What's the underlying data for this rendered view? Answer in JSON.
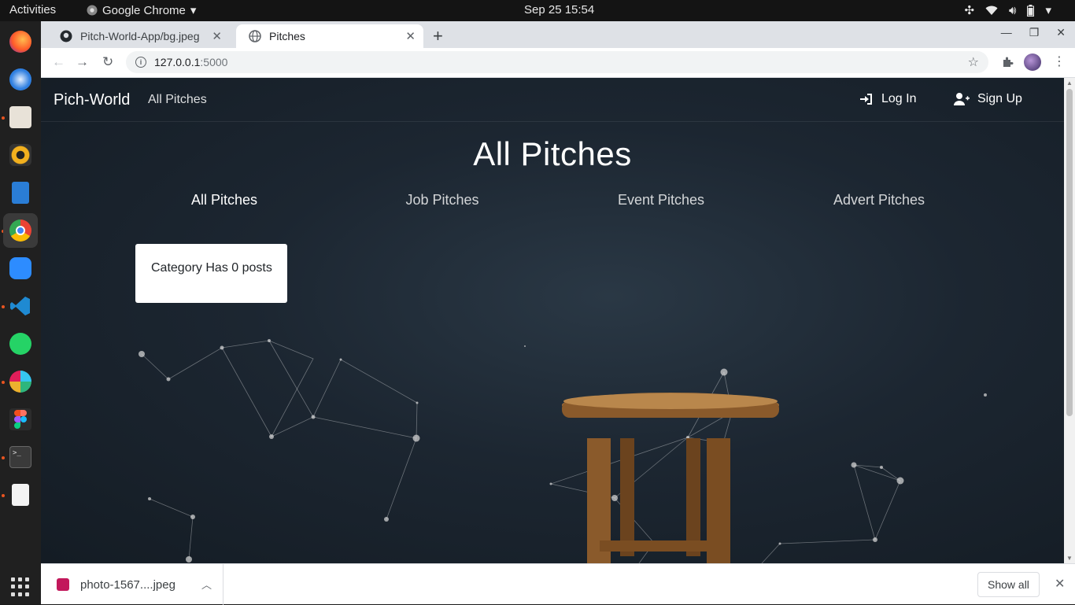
{
  "system": {
    "activities": "Activities",
    "app_name": "Google Chrome",
    "clock": "Sep 25  15:54"
  },
  "browser": {
    "tabs": [
      {
        "title": "Pitch-World-App/bg.jpeg",
        "favicon": "github-icon",
        "active": false
      },
      {
        "title": "Pitches",
        "favicon": "globe-icon",
        "active": true
      }
    ],
    "url_host": "127.0.0.1",
    "url_port": ":5000"
  },
  "site": {
    "brand": "Pich-World",
    "nav_link": "All Pitches",
    "login": "Log In",
    "signup": "Sign Up",
    "page_title": "All Pitches",
    "categories": [
      "All Pitches",
      "Job Pitches",
      "Event Pitches",
      "Advert Pitches"
    ],
    "selected_category": "All Pitches",
    "empty_message": "Category Has 0 posts"
  },
  "downloads": {
    "file": "photo-1567....jpeg",
    "show_all": "Show all"
  },
  "colors": {
    "page_bg": "#1c2631",
    "accent_dock": "#e95420",
    "card_bg": "#ffffff"
  }
}
